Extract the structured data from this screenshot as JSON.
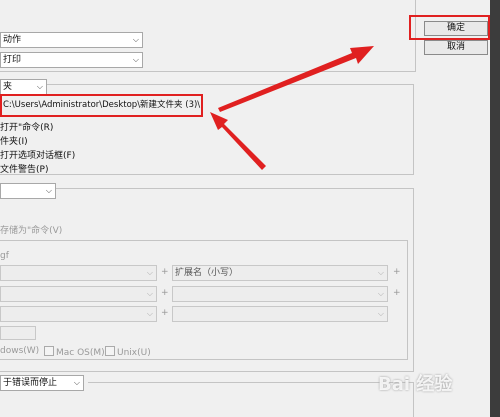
{
  "top": {
    "action_dropdown": "动作",
    "print_dropdown": "打印"
  },
  "buttons": {
    "ok": "确定",
    "cancel": "取消"
  },
  "folder_section": {
    "type_dropdown": "夹",
    "path": "C:\\Users\\Administrator\\Desktop\\新建文件夹 (3)\\",
    "options": [
      "打开\"命令(R)",
      "件夹(I)",
      "打开选项对话框(F)",
      "文件警告(P)"
    ]
  },
  "naming_section": {
    "save_as_command": "存储为\"命令(V)",
    "sub_label": "gf",
    "extension_dropdown": "扩展名（小写）",
    "plus": "+",
    "compat_windows": "dows(W)",
    "compat_mac": "Mac OS(M)",
    "compat_unix": "Unix(U)"
  },
  "error_dropdown": "于错误而停止",
  "watermark": "Bai 经验"
}
